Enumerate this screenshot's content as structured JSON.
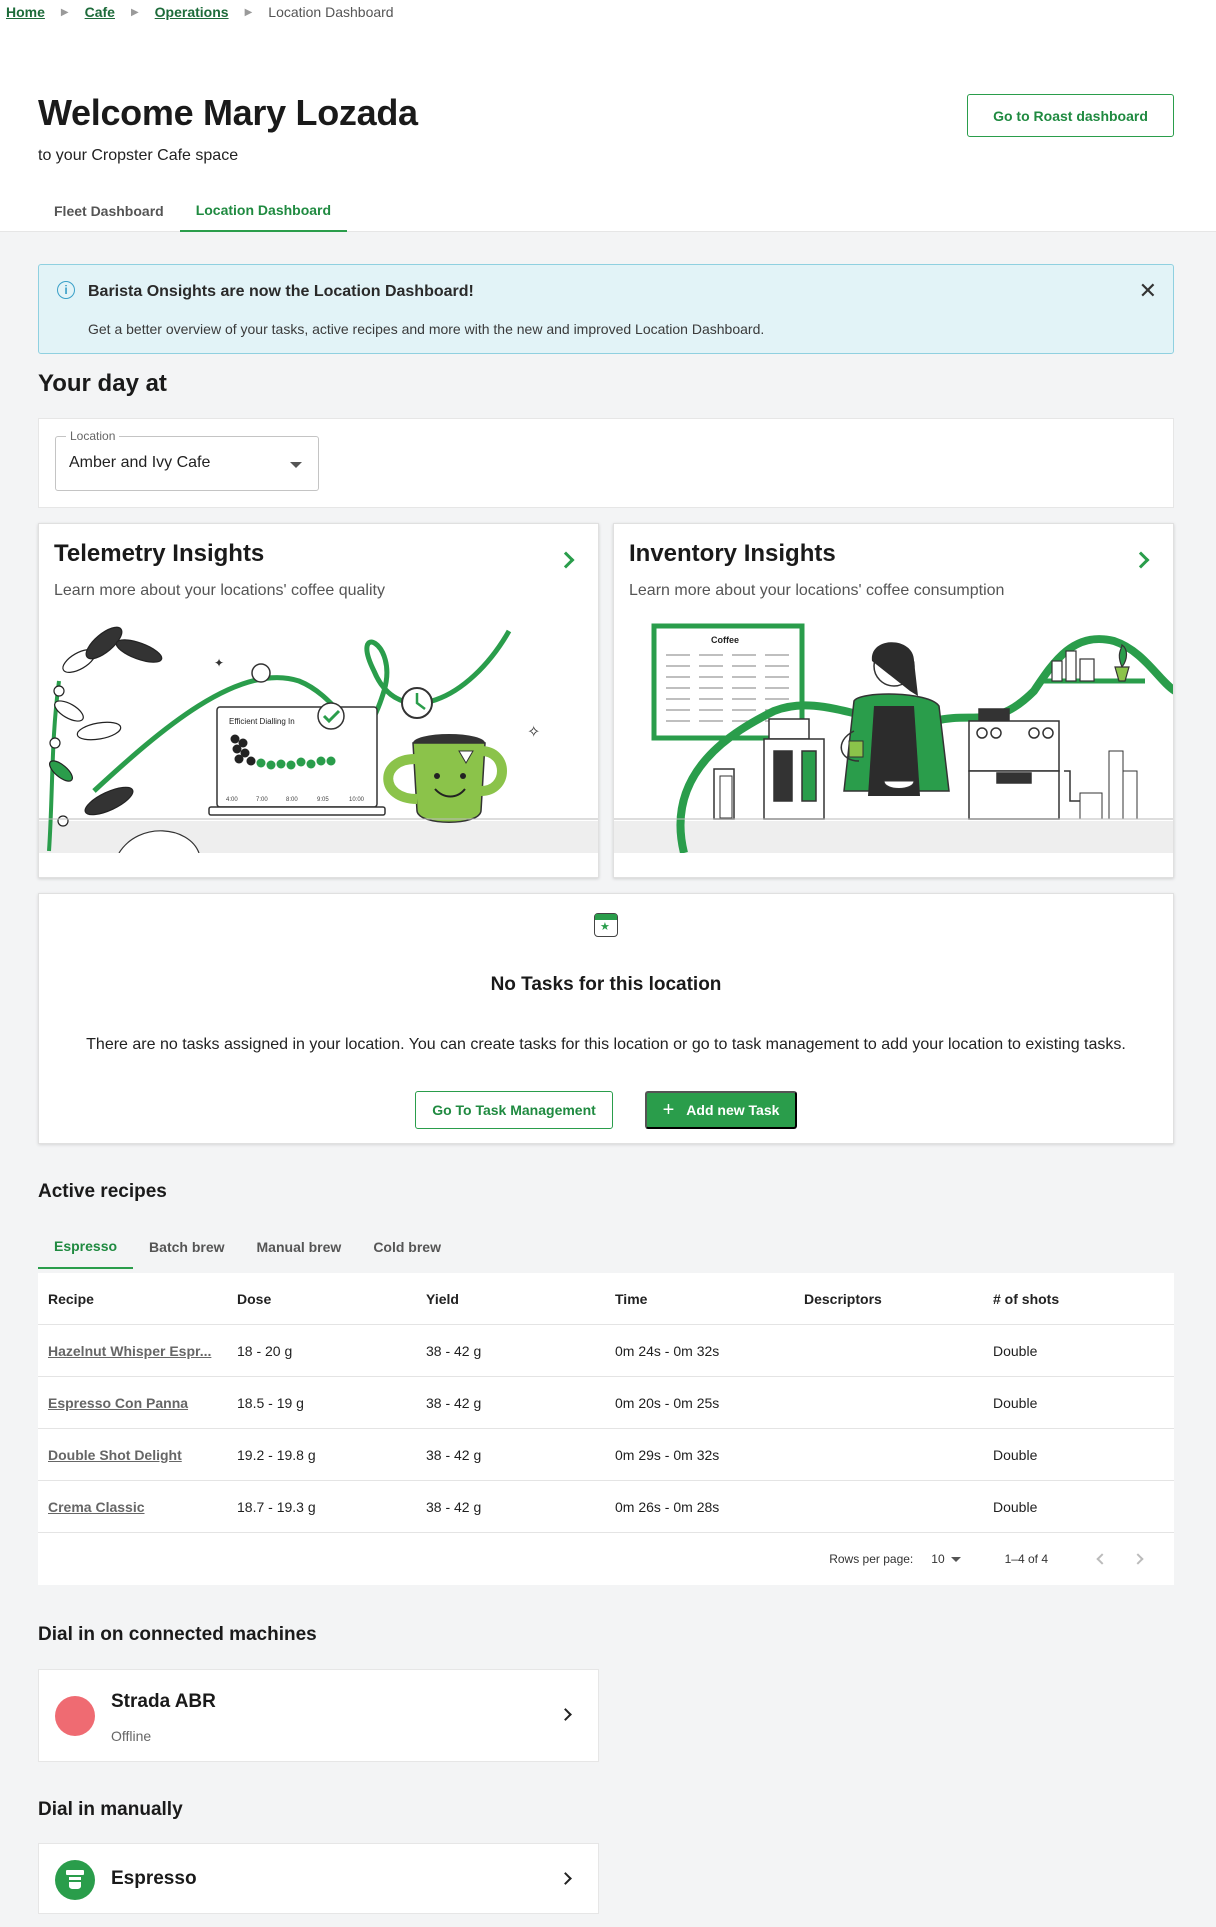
{
  "breadcrumb": {
    "items": [
      "Home",
      "Cafe",
      "Operations"
    ],
    "current": "Location Dashboard"
  },
  "header": {
    "welcome": "Welcome Mary Lozada",
    "subtitle": "to your Cropster Cafe space",
    "roast_button": "Go to Roast dashboard",
    "tabs": [
      "Fleet Dashboard",
      "Location Dashboard"
    ],
    "active_tab": "Location Dashboard"
  },
  "banner": {
    "title": "Barista Onsights are now the Location Dashboard!",
    "text": "Get a better overview of your tasks, active recipes and more with the new and improved Location Dashboard."
  },
  "day": {
    "title": "Your day at",
    "location_label": "Location",
    "location_value": "Amber and Ivy Cafe"
  },
  "insights": {
    "telemetry": {
      "title": "Telemetry Insights",
      "desc": "Learn more about your locations' coffee quality",
      "chart_title": "Efficient Dialling In",
      "chart_ticks": [
        "4:00",
        "7:00",
        "8:00",
        "9:05",
        "10:00"
      ]
    },
    "inventory": {
      "title": "Inventory Insights",
      "desc": "Learn more about your locations' coffee consumption",
      "board_label": "Coffee"
    }
  },
  "tasks": {
    "title": "No Tasks for this location",
    "text": "There are no tasks assigned in your location. You can create tasks for this location or go to task management to add your location to existing tasks.",
    "go_button": "Go To Task Management",
    "add_button": "Add new Task"
  },
  "recipes": {
    "title": "Active recipes",
    "tabs": [
      "Espresso",
      "Batch brew",
      "Manual brew",
      "Cold brew"
    ],
    "active_tab": "Espresso",
    "columns": [
      "Recipe",
      "Dose",
      "Yield",
      "Time",
      "Descriptors",
      "# of shots"
    ],
    "rows": [
      [
        "Hazelnut Whisper Espr...",
        "18 - 20 g",
        "38 - 42 g",
        "0m 24s - 0m 32s",
        "",
        "Double"
      ],
      [
        "Espresso Con Panna",
        "18.5 - 19 g",
        "38 - 42 g",
        "0m 20s - 0m 25s",
        "",
        "Double"
      ],
      [
        "Double Shot Delight",
        "19.2 - 19.8 g",
        "38 - 42 g",
        "0m 29s - 0m 32s",
        "",
        "Double"
      ],
      [
        "Crema Classic",
        "18.7 - 19.3 g",
        "38 - 42 g",
        "0m 26s - 0m 28s",
        "",
        "Double"
      ]
    ],
    "pager": {
      "rows_per_page_label": "Rows per page:",
      "rows_per_page": "10",
      "range": "1–4 of 4"
    }
  },
  "connected": {
    "title": "Dial in on connected machines",
    "machine_name": "Strada ABR",
    "machine_status": "Offline",
    "status_color": "#ef6b72"
  },
  "manual": {
    "title": "Dial in manually",
    "item": "Espresso"
  },
  "colors": {
    "accent": "#2a9d4b",
    "info_bg": "#e2f3f7"
  }
}
